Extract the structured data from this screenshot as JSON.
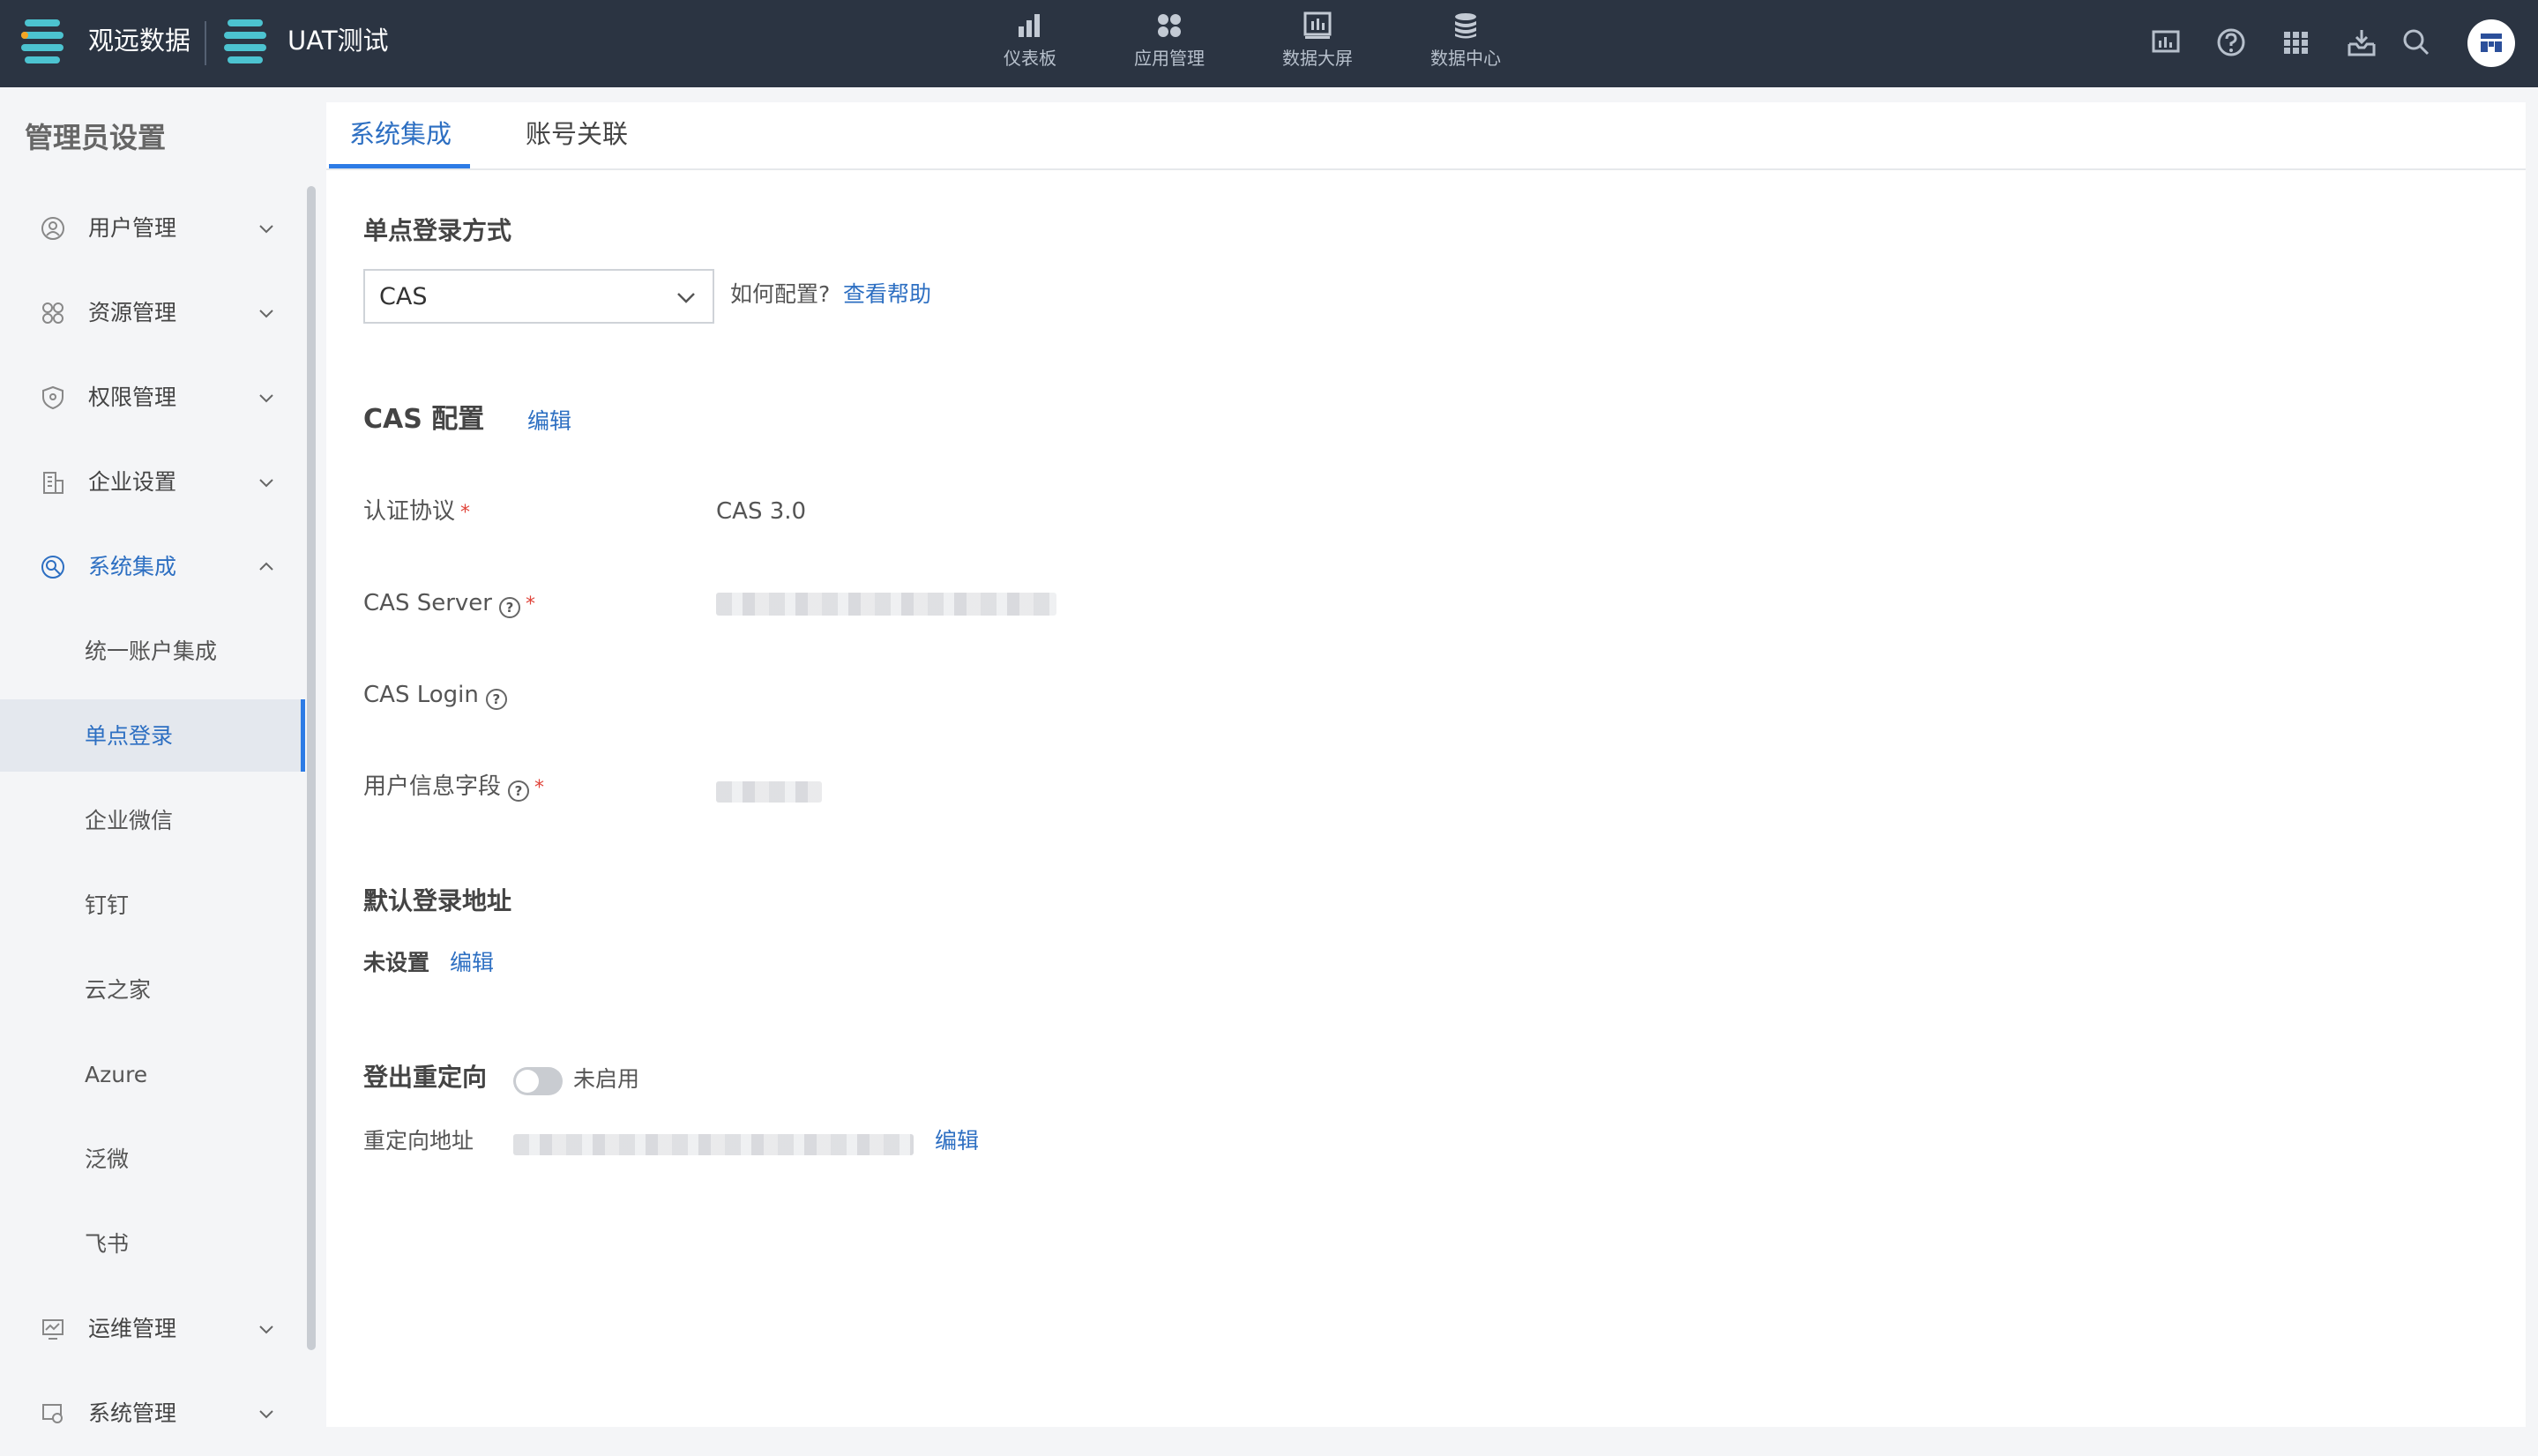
{
  "topbar": {
    "brand_name": "观远数据",
    "project_name": "UAT测试",
    "nav": [
      {
        "label": "仪表板",
        "icon": "bar-chart-icon"
      },
      {
        "label": "应用管理",
        "icon": "apps-grid-icon"
      },
      {
        "label": "数据大屏",
        "icon": "data-screen-icon"
      },
      {
        "label": "数据中心",
        "icon": "database-icon"
      }
    ],
    "right_icons": [
      "monitor-chart-icon",
      "help-icon",
      "app-launcher-icon",
      "download-tray-icon",
      "search-icon",
      "user-avatar"
    ]
  },
  "sidebar": {
    "title": "管理员设置",
    "items": [
      {
        "label": "用户管理",
        "icon": "user-icon",
        "expanded": false
      },
      {
        "label": "资源管理",
        "icon": "resource-icon",
        "expanded": false
      },
      {
        "label": "权限管理",
        "icon": "shield-icon",
        "expanded": false
      },
      {
        "label": "企业设置",
        "icon": "building-icon",
        "expanded": false
      },
      {
        "label": "系统集成",
        "icon": "integration-icon",
        "expanded": true
      },
      {
        "label": "运维管理",
        "icon": "monitor-icon",
        "expanded": false
      },
      {
        "label": "系统管理",
        "icon": "system-gear-icon",
        "expanded": false
      }
    ],
    "sub_items": [
      {
        "label": "统一账户集成",
        "active": false
      },
      {
        "label": "单点登录",
        "active": true
      },
      {
        "label": "企业微信",
        "active": false
      },
      {
        "label": "钉钉",
        "active": false
      },
      {
        "label": "云之家",
        "active": false
      },
      {
        "label": "Azure",
        "active": false
      },
      {
        "label": "泛微",
        "active": false
      },
      {
        "label": "飞书",
        "active": false
      }
    ]
  },
  "tabs": [
    {
      "label": "系统集成",
      "active": true
    },
    {
      "label": "账号关联",
      "active": false
    }
  ],
  "sso": {
    "section_title": "单点登录方式",
    "selected": "CAS",
    "how_to": "如何配置?",
    "help_link": "查看帮助"
  },
  "cas_config": {
    "title": "CAS 配置",
    "edit": "编辑",
    "fields": [
      {
        "label": "认证协议",
        "required": true,
        "help": false,
        "value": "CAS 3.0"
      },
      {
        "label": "CAS Server",
        "required": true,
        "help": true,
        "value": ""
      },
      {
        "label": "CAS Login",
        "required": false,
        "help": true,
        "value": ""
      },
      {
        "label": "用户信息字段",
        "required": true,
        "help": true,
        "value": ""
      }
    ]
  },
  "default_login": {
    "title": "默认登录地址",
    "value": "未设置",
    "edit": "编辑"
  },
  "logout_redirect": {
    "title": "登出重定向",
    "toggle_label": "未启用",
    "enabled": false,
    "address_label": "重定向地址",
    "edit": "编辑"
  },
  "required_mark": "*",
  "help_mark": "?"
}
